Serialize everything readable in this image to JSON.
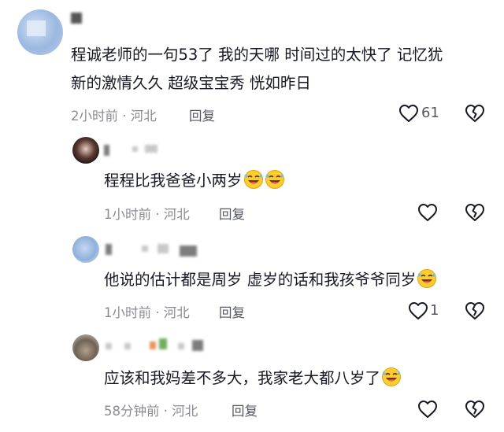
{
  "comments": [
    {
      "text_line1": "程诚老师的一句53了 我的天哪 时间过的太快了 记忆犹",
      "text_line2": "新的激情久久 超级宝宝秀 恍如昨日",
      "time": "2小时前",
      "sep": "·",
      "location": "河北",
      "reply_label": "回复",
      "likes": "61"
    },
    {
      "text": "程程比我爸爸小两岁",
      "time": "1小时前",
      "sep": "·",
      "location": "河北",
      "reply_label": "回复",
      "likes": ""
    },
    {
      "text": "他说的估计都是周岁 虚岁的话和我孩爷爷同岁",
      "time": "1小时前",
      "sep": "·",
      "location": "河北",
      "reply_label": "回复",
      "likes": "1"
    },
    {
      "text": "应该和我妈差不多大，我家老大都八岁了",
      "time": "58分钟前",
      "sep": "·",
      "location": "河北",
      "reply_label": "回复",
      "likes": ""
    }
  ],
  "icons": {
    "like": "heart-outline-icon",
    "dislike": "broken-heart-icon",
    "emoji": "laughing-crying-emoji-icon"
  }
}
